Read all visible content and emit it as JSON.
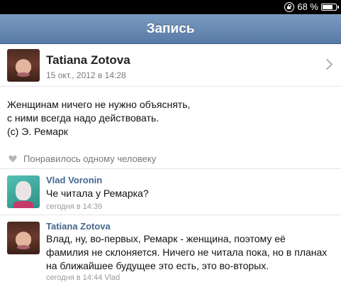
{
  "status_bar": {
    "battery": "68 %"
  },
  "nav": {
    "title": "Запись"
  },
  "post": {
    "author": "Tatiana Zotova",
    "date": "15 окт., 2012 в 14:28",
    "text_lines": [
      "Женщинам ничего не нужно объяснять,",
      "с ними всегда надо действовать.",
      "(с) Э. Ремарк"
    ],
    "likes": "Понравилось одному человеку"
  },
  "comments": [
    {
      "author": "Vlad Voronin",
      "text_lines": [
        "Че читала у Ремарка?"
      ],
      "date": "сегодня в 14:39"
    },
    {
      "author": "Tatiana Zotova",
      "text_lines": [
        "Влад, ну, во-первых, Ремарк - женщина, поэтому её",
        "фамилия не склоняется. Ничего не читала пока, но в планах",
        "на ближайшее будущее это есть, это во-вторых."
      ],
      "date": "сегодня в 14:44 Vlad"
    }
  ],
  "colors": {
    "nav_bar": "#577aa5",
    "comment_author": "#45688e",
    "meta_text": "#7a7a7a"
  },
  "icons": {
    "status_lock": "orientation-lock-icon",
    "battery": "battery-icon",
    "disclosure": "chevron-right-icon",
    "like": "heart-icon"
  }
}
